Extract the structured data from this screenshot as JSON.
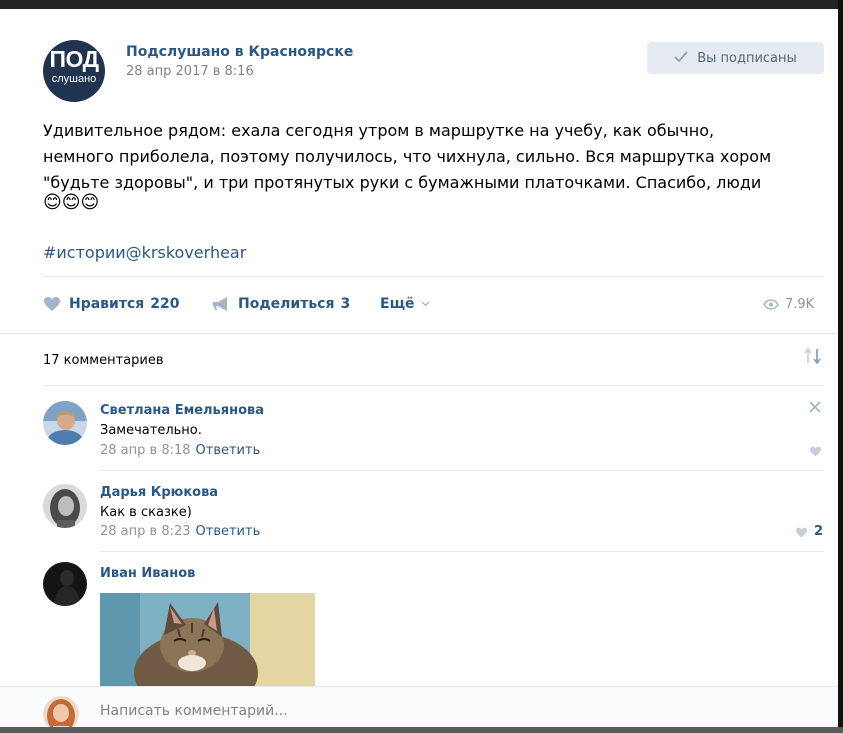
{
  "post": {
    "group_name": "Подслушано в Красноярске",
    "date": "28 апр 2017 в 8:16",
    "avatar_text_big": "ПОД",
    "avatar_text_small": "слушано",
    "subscribed_label": "Вы подписаны",
    "text_lines": [
      "Удивительное рядом: ехала сегодня утром в маршрутке на учебу, как обычно,",
      "немного приболела, поэтому получилось, что чихнула, сильно. Вся маршрутка хором",
      "\"будьте здоровы\", и три протянутых руки с бумажными платочками. Спасибо, люди"
    ],
    "emojis": "😊😊😊",
    "hashtag": "#истории@krskoverhear"
  },
  "actions": {
    "like_label": "Нравится",
    "like_count": "220",
    "share_label": "Поделиться",
    "share_count": "3",
    "more_label": "Ещё",
    "views": "7.9K"
  },
  "comments_header": {
    "count_label": "17 комментариев"
  },
  "comments": [
    {
      "author": "Светлана Емельянова",
      "text": "Замечательно.",
      "time": "28 апр в 8:18",
      "reply_label": "Ответить",
      "likes": ""
    },
    {
      "author": "Дарья Крюкова",
      "text": "Как в сказке)",
      "time": "28 апр в 8:23",
      "reply_label": "Ответить",
      "likes": "2"
    },
    {
      "author": "Иван Иванов",
      "text": "",
      "time": "",
      "reply_label": "",
      "likes": ""
    }
  ],
  "composer": {
    "placeholder": "Написать комментарий..."
  },
  "colors": {
    "link": "#2a5885",
    "muted": "#939393",
    "button_bg": "#e5ebf1"
  }
}
